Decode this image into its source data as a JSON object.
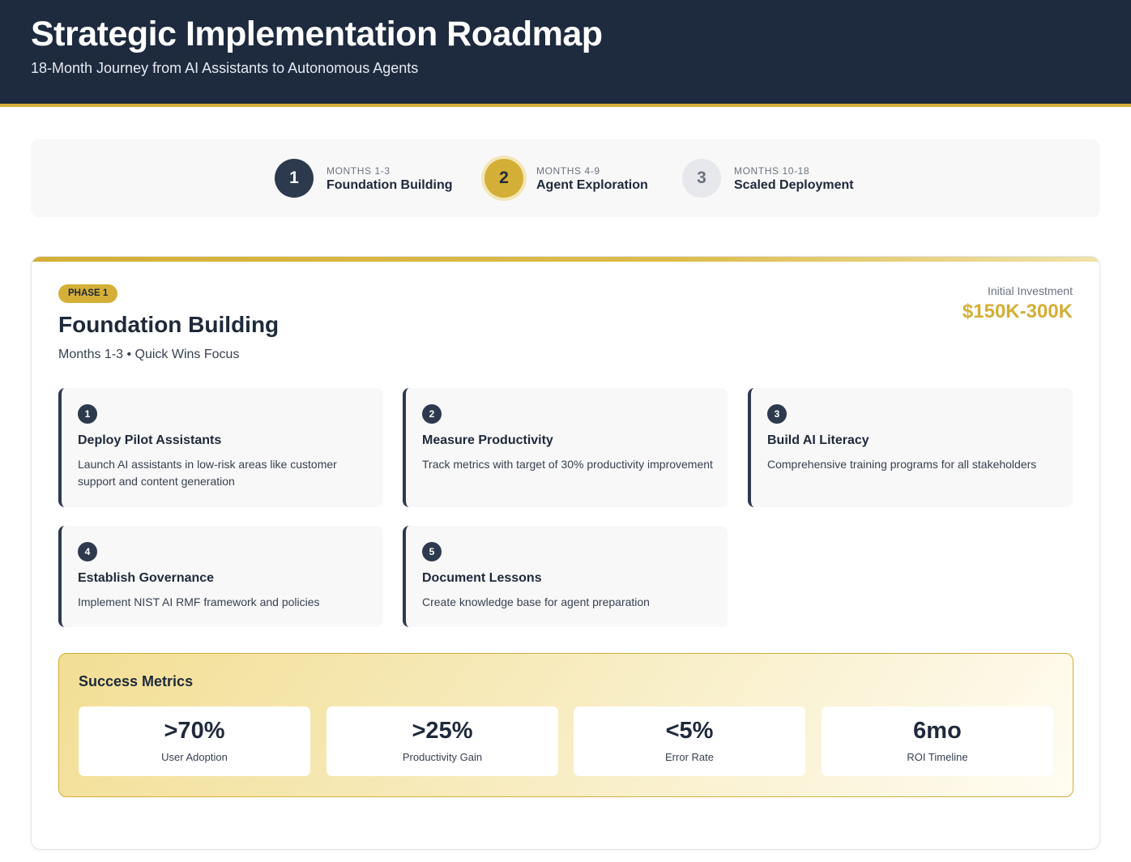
{
  "header": {
    "title": "Strategic Implementation Roadmap",
    "subtitle": "18-Month Journey from AI Assistants to Autonomous Agents"
  },
  "stepper": {
    "steps": [
      {
        "number": "1",
        "range": "MONTHS 1-3",
        "name": "Foundation Building",
        "state": "completed"
      },
      {
        "number": "2",
        "range": "MONTHS 4-9",
        "name": "Agent Exploration",
        "state": "active"
      },
      {
        "number": "3",
        "range": "MONTHS 10-18",
        "name": "Scaled Deployment",
        "state": "pending"
      }
    ]
  },
  "phase": {
    "badge": "PHASE 1",
    "title": "Foundation Building",
    "subtitle": "Months 1-3 • Quick Wins Focus",
    "investment_label": "Initial Investment",
    "investment_value": "$150K-300K",
    "tasks": [
      {
        "number": "1",
        "title": "Deploy Pilot Assistants",
        "description": "Launch AI assistants in low-risk areas like customer support and content generation"
      },
      {
        "number": "2",
        "title": "Measure Productivity",
        "description": "Track metrics with target of 30% productivity improvement"
      },
      {
        "number": "3",
        "title": "Build AI Literacy",
        "description": "Comprehensive training programs for all stakeholders"
      },
      {
        "number": "4",
        "title": "Establish Governance",
        "description": "Implement NIST AI RMF framework and policies"
      },
      {
        "number": "5",
        "title": "Document Lessons",
        "description": "Create knowledge base for agent preparation"
      }
    ],
    "metrics": {
      "title": "Success Metrics",
      "items": [
        {
          "value": ">70%",
          "label": "User Adoption"
        },
        {
          "value": ">25%",
          "label": "Productivity Gain"
        },
        {
          "value": "<5%",
          "label": "Error Rate"
        },
        {
          "value": "6mo",
          "label": "ROI Timeline"
        }
      ]
    }
  },
  "colors": {
    "navy": "#1e2a3e",
    "gold": "#d4af37",
    "slate": "#2d3a4e",
    "card_bg": "#f8f8f8"
  }
}
